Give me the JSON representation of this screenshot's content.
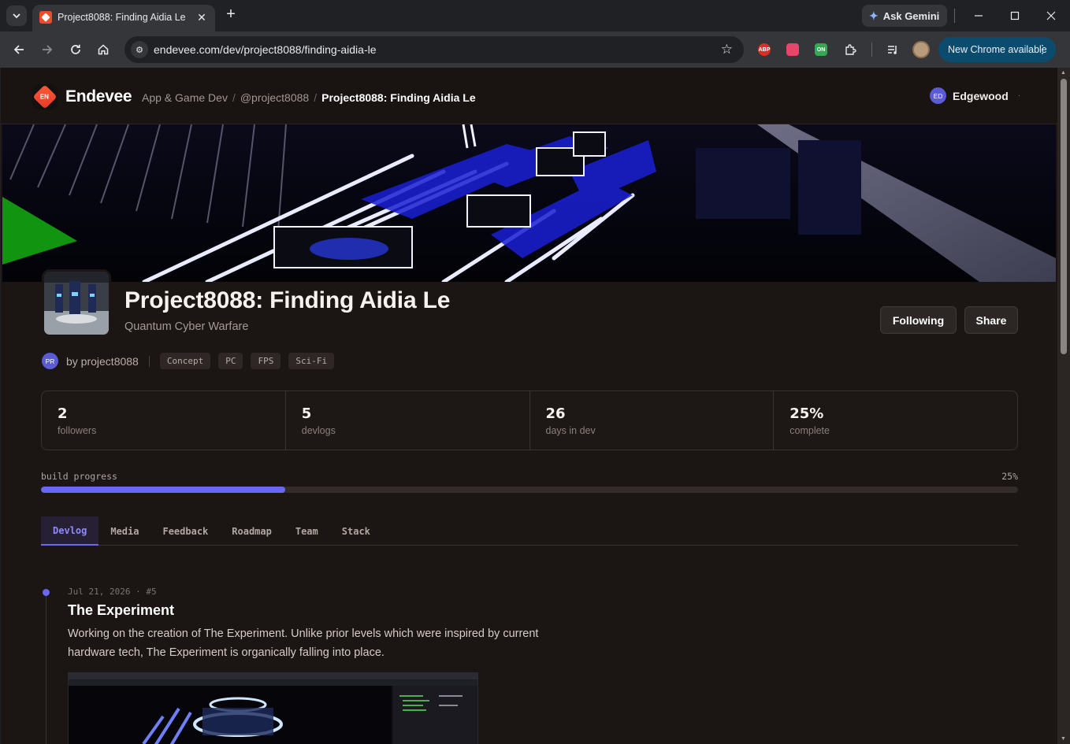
{
  "browser": {
    "tab_title": "Project8088: Finding Aidia Le",
    "gemini_label": "Ask Gemini",
    "url": "endevee.com/dev/project8088/finding-aidia-le",
    "new_chrome_label": "New Chrome available",
    "ext_abp": "ABP",
    "ext_on": "ON"
  },
  "site": {
    "brand": "Endevee",
    "logo_text": "EN",
    "breadcrumbs": [
      "App & Game Dev",
      "@project8088",
      "Project8088: Finding Aidia Le"
    ],
    "user": {
      "initials": "ED",
      "name": "Edgewood"
    }
  },
  "project": {
    "title": "Project8088: Finding Aidia Le",
    "subtitle": "Quantum Cyber Warfare",
    "following_label": "Following",
    "share_label": "Share",
    "author_initials": "PR",
    "byline": "by project8088",
    "tags": [
      "Concept",
      "PC",
      "FPS",
      "Sci-Fi"
    ]
  },
  "stats": [
    {
      "value": "2",
      "label": "followers"
    },
    {
      "value": "5",
      "label": "devlogs"
    },
    {
      "value": "26",
      "label": "days in dev"
    },
    {
      "value": "25%",
      "label": "complete"
    }
  ],
  "progress": {
    "label": "build progress",
    "percent_text": "25%",
    "fraction": 0.25
  },
  "tabs": [
    "Devlog",
    "Media",
    "Feedback",
    "Roadmap",
    "Team",
    "Stack"
  ],
  "active_tab": "Devlog",
  "devlog": {
    "meta": "Jul 21, 2026 · #5",
    "title": "The Experiment",
    "body": "Working on the creation of The Experiment. Unlike prior levels which were inspired by current hardware tech, The Experiment is organically falling into place."
  },
  "colors": {
    "accent": "#6a67f0",
    "page_bg": "#1b1513",
    "new_chrome_bg": "#0b4b6e"
  }
}
